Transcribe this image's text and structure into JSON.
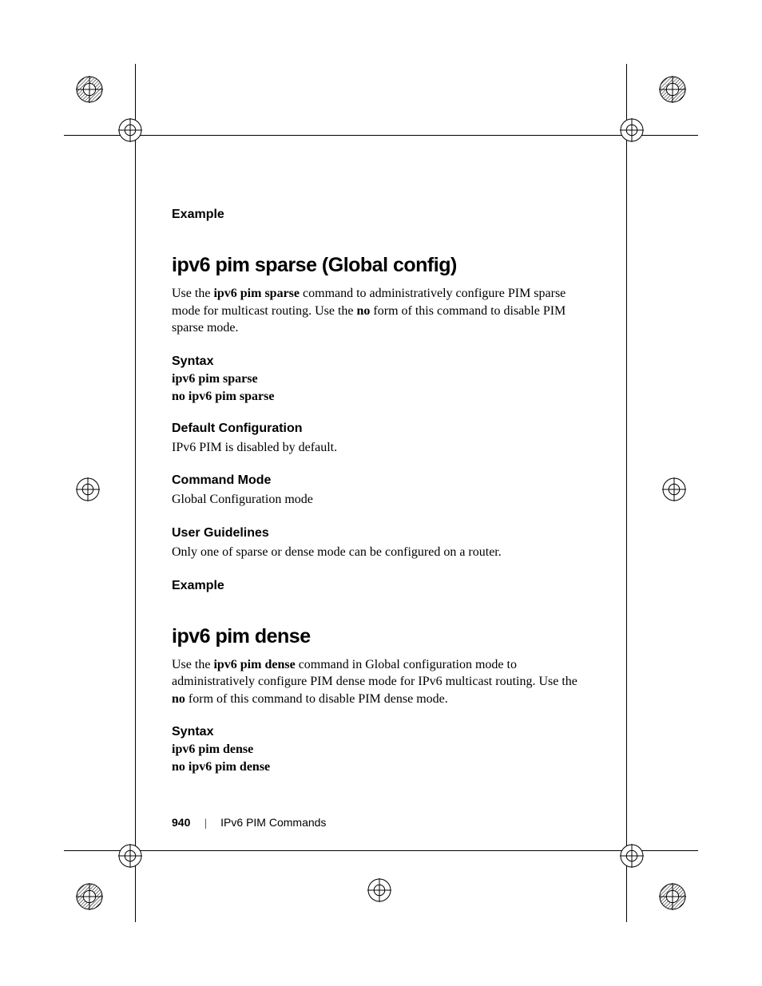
{
  "sections": {
    "example_top": "Example",
    "h1": {
      "title": "ipv6 pim sparse (Global config)"
    },
    "p1": {
      "a": "Use the ",
      "cmd": "ipv6 pim sparse",
      "b": " command to administratively configure PIM sparse mode for multicast routing. Use the ",
      "no": "no",
      "c": " form of this command to disable PIM sparse mode."
    },
    "syntax1": {
      "heading": "Syntax",
      "line1": "ipv6 pim sparse",
      "line2": "no ipv6 pim sparse"
    },
    "default_cfg": {
      "heading": "Default Configuration",
      "text": "IPv6 PIM is disabled by default."
    },
    "cmd_mode": {
      "heading": "Command Mode",
      "text": "Global Configuration mode"
    },
    "user_guidelines": {
      "heading": "User Guidelines",
      "text": "Only one of sparse or dense mode can be configured on a router."
    },
    "example_mid": "Example",
    "h2": {
      "title": "ipv6 pim dense"
    },
    "p2": {
      "a": "Use the ",
      "cmd": "ipv6 pim dense",
      "b": " command in Global configuration mode to administratively configure PIM dense mode for IPv6 multicast routing. Use the ",
      "no": "no",
      "c": " form of this command to disable PIM dense mode."
    },
    "syntax2": {
      "heading": "Syntax",
      "line1": "ipv6 pim dense",
      "line2": "no ipv6 pim dense"
    }
  },
  "footer": {
    "page_number": "940",
    "separator": "|",
    "title": "IPv6 PIM Commands"
  }
}
